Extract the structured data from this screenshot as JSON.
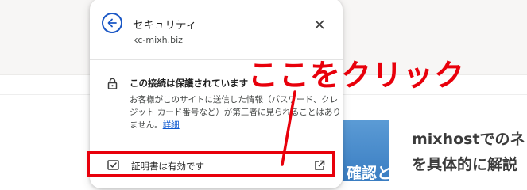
{
  "page": {
    "thumbnail_text": "確認と",
    "article_lines": [
      "mixhostでのネ",
      "を具体的に解説"
    ]
  },
  "popup": {
    "title": "セキュリティ",
    "domain": "kc-mixh.biz",
    "security_heading": "この接続は保護されています",
    "security_desc_lines": [
      "お客様がこのサイトに送信した情報（パスワード、クレ",
      "ジット カード番号など）が第三者に見られることはあり",
      "ません。"
    ],
    "details_link": "詳細",
    "certificate_label": "証明書は有効です"
  },
  "annotation": {
    "text": "ここをクリック",
    "color": "#e8000b"
  },
  "icons": {
    "back": "arrow-left-circle-icon",
    "close": "close-icon",
    "lock": "lock-icon",
    "certificate": "certificate-icon",
    "external": "external-link-icon"
  },
  "colors": {
    "accent_blue": "#1a57c5",
    "highlight_red": "#e8000b",
    "thumbnail_blue": "#3a7dc2"
  }
}
